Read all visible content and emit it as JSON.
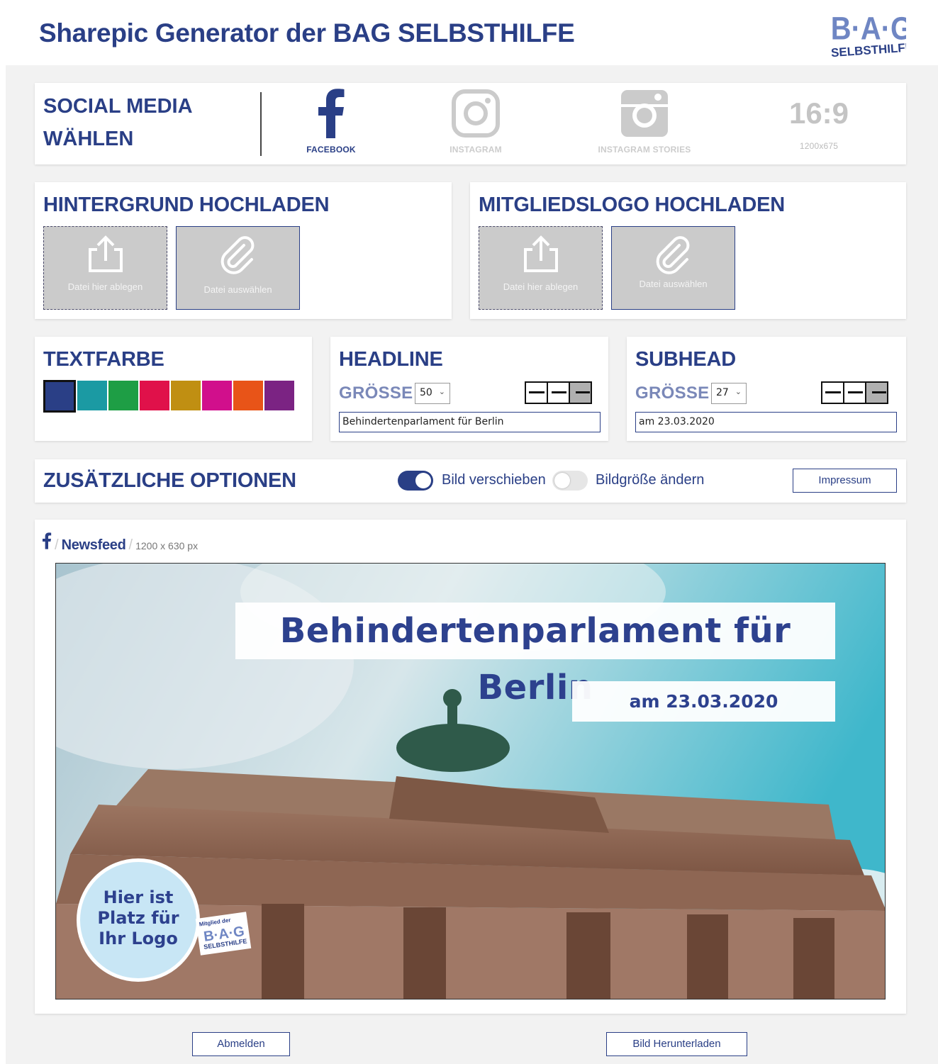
{
  "header": {
    "title": "Sharepic Generator der BAG SELBSTHILFE",
    "logo_text_top": "B·A·G",
    "logo_text_bottom": "SELBSTHILFE"
  },
  "social": {
    "title_line1": "SOCIAL MEDIA",
    "title_line2": "WÄHLEN",
    "options": [
      {
        "label": "FACEBOOK",
        "active": true
      },
      {
        "label": "INSTAGRAM",
        "active": false
      },
      {
        "label": "INSTAGRAM STORIES",
        "active": false
      },
      {
        "label": "1200x675",
        "ratio": "16:9",
        "active": false
      }
    ]
  },
  "background_upload": {
    "title": "HINTERGRUND HOCHLADEN",
    "drop_label": "Datei hier ablegen",
    "pick_label": "Datei auswählen"
  },
  "logo_upload": {
    "title": "MITGLIEDSLOGO HOCHLADEN",
    "drop_label": "Datei hier ablegen",
    "pick_label": "Datei auswählen"
  },
  "text_color": {
    "title": "TEXTFARBE",
    "swatches": [
      "#2a3f86",
      "#1b9aa3",
      "#1e9e45",
      "#e0114a",
      "#c08f12",
      "#d10f8c",
      "#e85418",
      "#7b2383"
    ],
    "selected_index": 0
  },
  "headline": {
    "title": "HEADLINE",
    "size_label": "GRÖSSE",
    "size_value": "50",
    "text_value": "Behindertenparlament für Berlin",
    "align_active": "right"
  },
  "subhead": {
    "title": "SUBHEAD",
    "size_label": "GRÖSSE",
    "size_value": "27",
    "text_value": "am 23.03.2020",
    "align_active": "right"
  },
  "options": {
    "title": "ZUSÄTZLICHE OPTIONEN",
    "toggle_move_label": "Bild verschieben",
    "toggle_move_on": true,
    "toggle_resize_label": "Bildgröße ändern",
    "toggle_resize_on": false,
    "impressum_label": "Impressum"
  },
  "preview": {
    "network_icon": "facebook-icon",
    "format": "Newsfeed",
    "dimensions": "1200 x 630 px",
    "headline": "Behindertenparlament für Berlin",
    "subhead": "am 23.03.2020",
    "logo_placeholder_line1": "Hier ist",
    "logo_placeholder_line2": "Platz für",
    "logo_placeholder_line3": "Ihr Logo",
    "member_badge_caption": "Mitglied der",
    "member_badge_top": "B·A·G",
    "member_badge_bottom": "SELBSTHILFE"
  },
  "footer": {
    "logout_label": "Abmelden",
    "download_label": "Bild Herunterladen"
  },
  "colors": {
    "brand": "#2a3f86",
    "toggle_on": "#2a3f86",
    "toggle_off": "#e6e6e6"
  }
}
